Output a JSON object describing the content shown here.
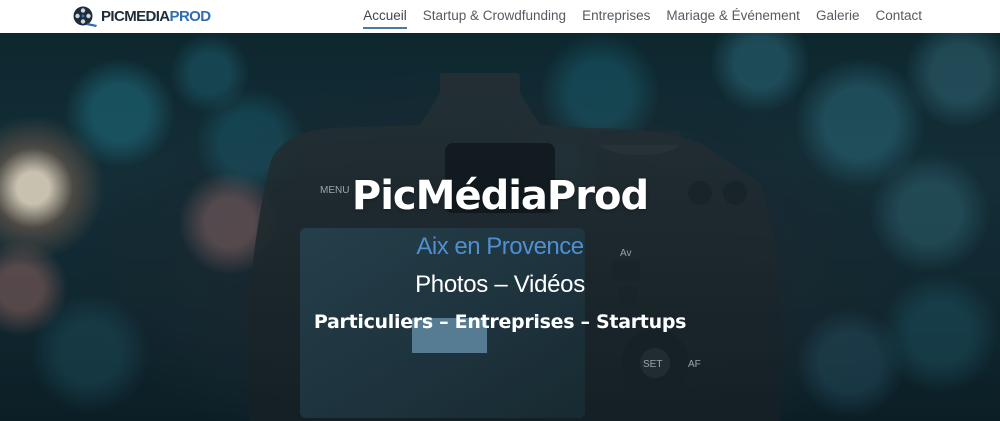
{
  "header": {
    "logo": {
      "icon": "film-reel-logo-icon",
      "text_part1": "PICMEDIA",
      "text_part2": "PROD"
    },
    "nav": [
      {
        "label": "Accueil",
        "active": true
      },
      {
        "label": "Startup & Crowdfunding",
        "active": false
      },
      {
        "label": "Entreprises",
        "active": false
      },
      {
        "label": "Mariage & Événement",
        "active": false
      },
      {
        "label": "Galerie",
        "active": false
      },
      {
        "label": "Contact",
        "active": false
      }
    ]
  },
  "hero": {
    "background": "camera-photo",
    "camera_labels": {
      "menu": "MENU",
      "av": "Av",
      "set": "SET",
      "af": "AF"
    },
    "title": "PicMédiaProd",
    "location": "Aix en Provence",
    "services": "Photos – Vidéos",
    "clients": "Particuliers – Entreprises – Startups"
  },
  "colors": {
    "accent": "#4f8fd0",
    "nav_underline": "#4a78a8",
    "logo_blue": "#2f6eb2"
  }
}
